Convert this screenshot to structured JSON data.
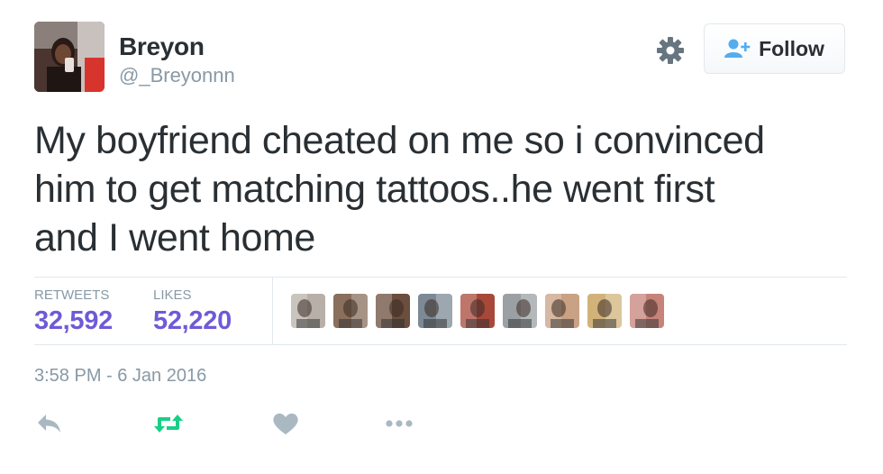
{
  "user": {
    "display_name": "Breyon",
    "screen_name": "@_Breyonnn",
    "avatar_icon": "profile-photo"
  },
  "header": {
    "settings_icon": "gear-icon",
    "follow_button": {
      "label": "Follow",
      "icon": "add-user-icon"
    }
  },
  "tweet": {
    "text_lines": [
      "My boyfriend cheated on me so i convinced",
      "him to get matching tattoos..he went first",
      "and I went home"
    ]
  },
  "stats": {
    "retweets_label": "RETWEETS",
    "retweets_value": "32,592",
    "likes_label": "LIKES",
    "likes_value": "52,220"
  },
  "likers": [
    {
      "name": "liker-1",
      "color": "#b8b0a8"
    },
    {
      "name": "liker-2",
      "color": "#8a6f5c"
    },
    {
      "name": "liker-3",
      "color": "#6b4e3d"
    },
    {
      "name": "liker-4",
      "color": "#7d8a96"
    },
    {
      "name": "liker-5",
      "color": "#a8483a"
    },
    {
      "name": "liker-6",
      "color": "#9aa0a3"
    },
    {
      "name": "liker-7",
      "color": "#c9a184"
    },
    {
      "name": "liker-8",
      "color": "#d1b37a"
    },
    {
      "name": "liker-9",
      "color": "#c7827a"
    }
  ],
  "timestamp": "3:58 PM - 6 Jan 2016",
  "actions": {
    "reply_icon": "reply-icon",
    "retweet_icon": "retweet-icon",
    "like_icon": "heart-icon",
    "more_icon": "more-icon"
  },
  "colors": {
    "accent_purple": "#6e5bd6",
    "retweet_green": "#19cf86",
    "muted": "#8899a6",
    "text": "#292f33",
    "follow_icon_blue": "#55acee"
  }
}
